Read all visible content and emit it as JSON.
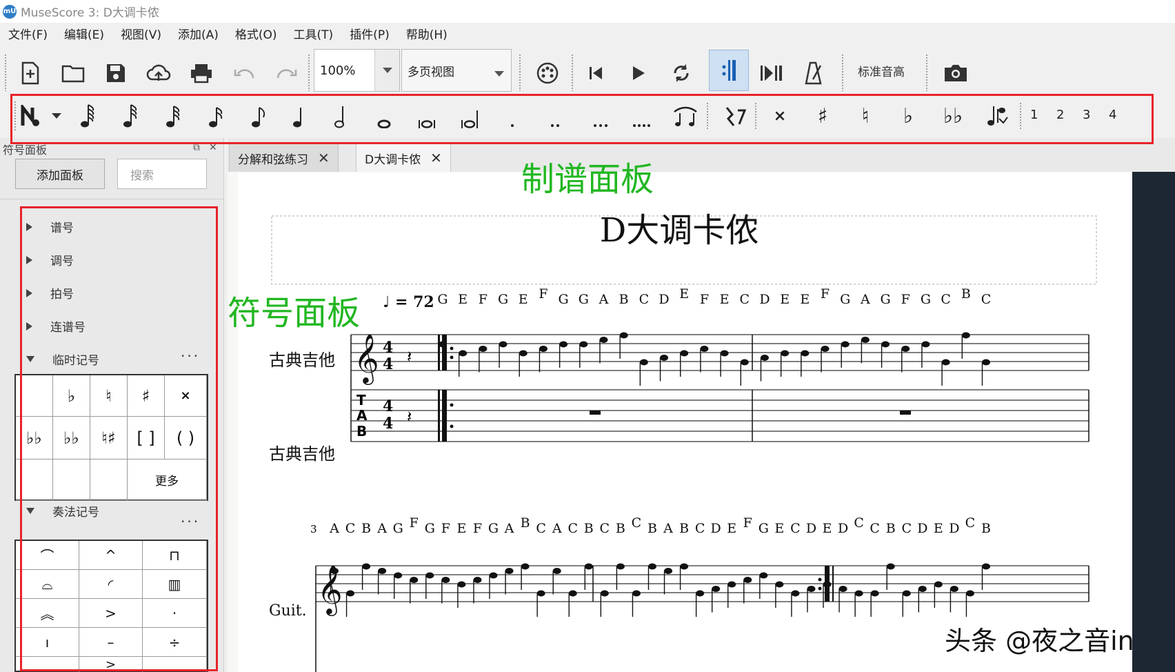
{
  "window": {
    "title": "MuseScore 3: D大调卡侬",
    "logo_text": "mU"
  },
  "menu": [
    "文件(F)",
    "编辑(E)",
    "视图(V)",
    "添加(A)",
    "格式(O)",
    "工具(T)",
    "插件(P)",
    "帮助(H)"
  ],
  "toolbar": {
    "zoom": "100%",
    "view_mode": "多页视图",
    "concert_pitch": "标准音高"
  },
  "note_input": {
    "voices": [
      "1",
      "2",
      "3",
      "4"
    ]
  },
  "palette": {
    "title": "符号面板",
    "add_button": "添加面板",
    "search_placeholder": "搜索",
    "sections": [
      "谱号",
      "调号",
      "拍号",
      "连谱号",
      "临时记号",
      "奏法记号"
    ],
    "accidentals": [
      "",
      "♭",
      "♮",
      "♯",
      "𝄪",
      "𝄫",
      "♭",
      "♯",
      "[ ]",
      "( )",
      "",
      "",
      "更多"
    ],
    "articulations": [
      "𝄐",
      "^",
      "⊓",
      "𝄑",
      "ᐢ",
      "⊓",
      ">",
      "·",
      "'",
      "–",
      "ⁱ"
    ]
  },
  "tabs": [
    {
      "label": "分解和弦练习",
      "active": false
    },
    {
      "label": "D大调卡侬",
      "active": true
    }
  ],
  "score": {
    "title": "D大调卡侬",
    "tempo": "♩ = 72",
    "instrument_long": "古典吉他",
    "instrument_tab": "古典吉他",
    "instrument_short": "Guit.",
    "measure_number": "3",
    "row1_letters": [
      "G",
      "E",
      "F",
      "G",
      "E",
      "F",
      "G",
      "G",
      "A",
      "B",
      "C",
      "D",
      "E",
      "F",
      "E",
      "C",
      "D",
      "E",
      "E",
      "F",
      "G",
      "A",
      "G",
      "F",
      "G",
      "C",
      "B",
      "C"
    ],
    "row2_letters": [
      "A",
      "C",
      "B",
      "A",
      "G",
      "F",
      "G",
      "F",
      "E",
      "F",
      "G",
      "A",
      "B",
      "C",
      "A",
      "C",
      "B",
      "C",
      "B",
      "C",
      "B",
      "A",
      "B",
      "C",
      "D",
      "E",
      "F",
      "G",
      "E",
      "C",
      "D",
      "E",
      "D",
      "C",
      "C",
      "B",
      "C",
      "D",
      "E",
      "D",
      "C",
      "B"
    ]
  },
  "annotations": {
    "toolbar_label": "制谱面板",
    "palette_label": "符号面板"
  },
  "watermark": "头条 @夜之音in",
  "colors": {
    "annotation": "#22b722",
    "highlight": "#e8232a",
    "accent": "#2f7ec7"
  }
}
